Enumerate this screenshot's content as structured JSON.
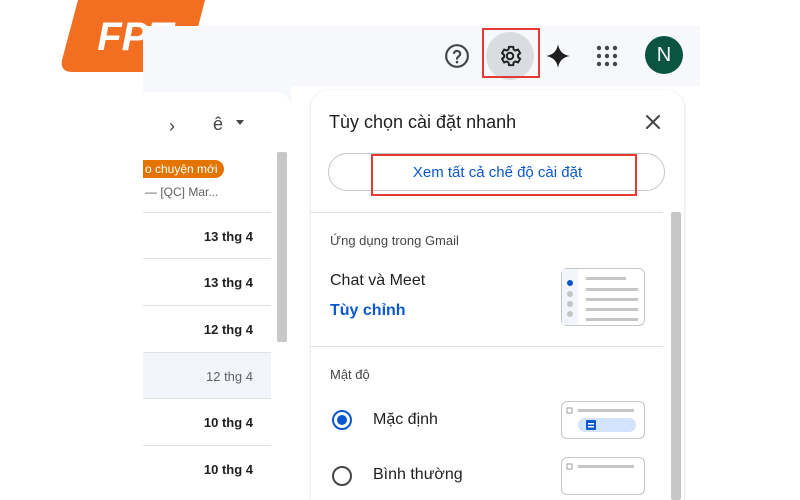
{
  "logo": {
    "text": "FPT",
    "color": "#f26f21"
  },
  "toolbar": {
    "help_icon": "help-circle-icon",
    "settings_icon": "gear-icon",
    "gemini_icon": "sparkle-icon",
    "apps_icon": "apps-grid-icon",
    "avatar_initial": "N",
    "avatar_color": "#0b5343"
  },
  "mail": {
    "nav_lang": "ê",
    "promo_badge": "o chuyện mới",
    "promo_sub": "— [QC] Mar...",
    "rows": [
      {
        "date": "13 thg 4",
        "read": false
      },
      {
        "date": "13 thg 4",
        "read": false
      },
      {
        "date": "12 thg 4",
        "read": false
      },
      {
        "date": "12 thg 4",
        "read": true
      },
      {
        "date": "10 thg 4",
        "read": false
      },
      {
        "date": "10 thg 4",
        "read": false
      }
    ]
  },
  "quick_settings": {
    "title": "Tùy chọn cài đặt nhanh",
    "see_all": "Xem tất cả chế độ cài đặt",
    "apps_section": "Ứng dụng trong Gmail",
    "chat_meet": "Chat và Meet",
    "customize": "Tùy chỉnh",
    "density_section": "Mật độ",
    "density_options": [
      {
        "label": "Mặc định",
        "selected": true
      },
      {
        "label": "Bình thường",
        "selected": false
      }
    ]
  },
  "colors": {
    "highlight": "#e53935",
    "accent": "#0b57d0"
  }
}
